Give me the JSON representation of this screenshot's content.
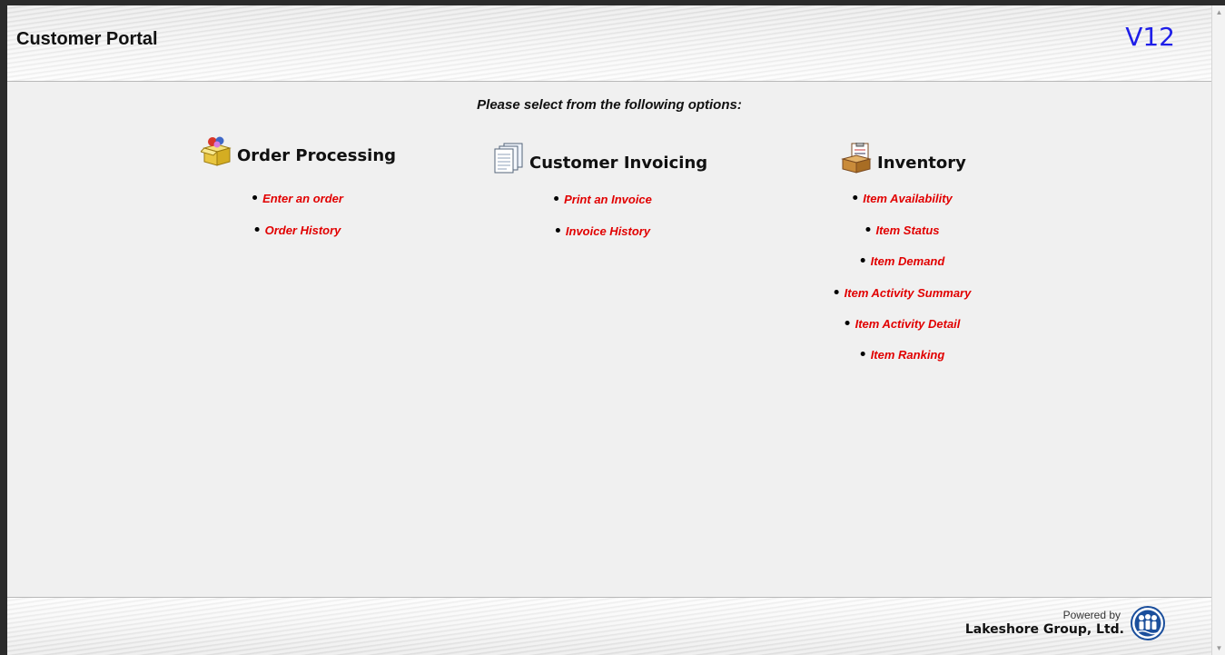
{
  "header": {
    "title": "Customer Portal",
    "version": "V12"
  },
  "instruction": "Please select from the following options:",
  "sections": [
    {
      "title": "Order Processing",
      "icon": "package-icon",
      "links": [
        "Enter an order",
        "Order History"
      ]
    },
    {
      "title": "Customer Invoicing",
      "icon": "documents-icon",
      "links": [
        "Print an Invoice",
        "Invoice History"
      ]
    },
    {
      "title": "Inventory",
      "icon": "clipboard-box-icon",
      "links": [
        "Item Availability",
        "Item Status",
        "Item Demand",
        "Item Activity Summary",
        "Item Activity Detail",
        "Item Ranking"
      ]
    }
  ],
  "footer": {
    "powered_by": "Powered by",
    "company": "Lakeshore Group, Ltd."
  },
  "colors": {
    "link": "#e10000",
    "version": "#1f1fe8"
  }
}
